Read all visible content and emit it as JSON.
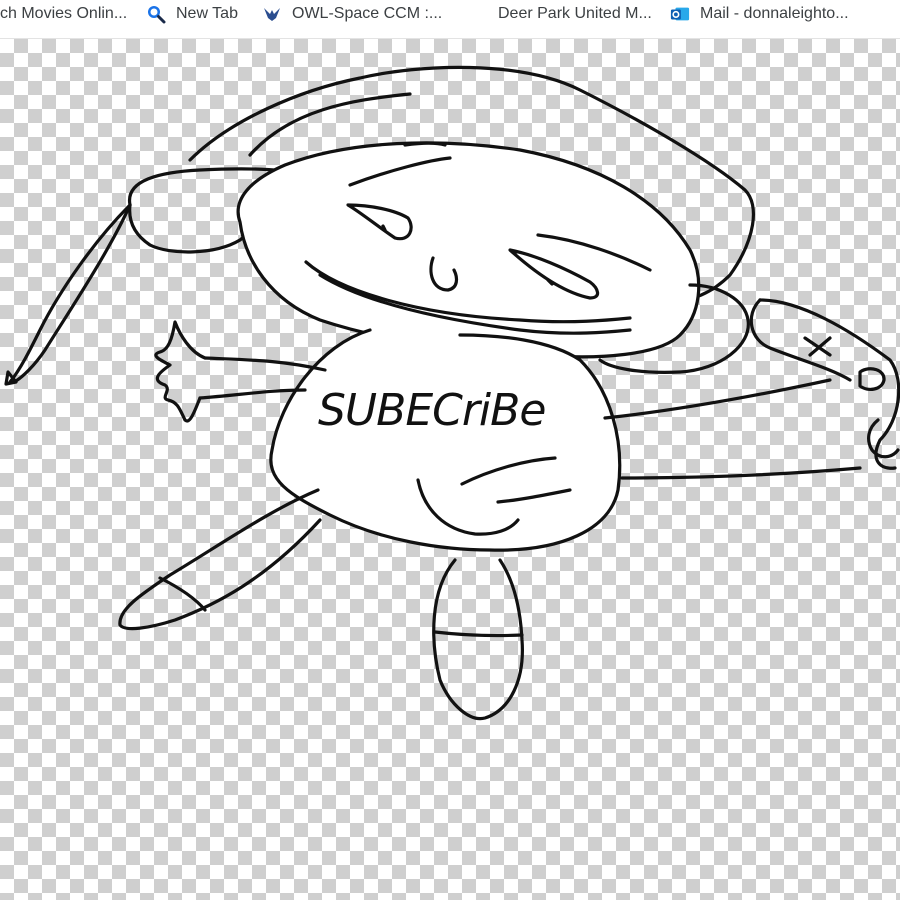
{
  "bookmarks_bar": {
    "items": [
      {
        "label": "ch Movies Onlin...",
        "icon": "none"
      },
      {
        "label": "New Tab",
        "icon": "search-magnifier-icon"
      },
      {
        "label": "OWL-Space CCM :...",
        "icon": "owl-bird-icon"
      },
      {
        "label": "Deer Park United M...",
        "icon": "none"
      },
      {
        "label": "Mail - donnaleighto...",
        "icon": "outlook-mail-icon"
      }
    ]
  },
  "drawing": {
    "shirt_text": "SUBECriBe",
    "background": "transparent-checkerboard",
    "stroke_color": "#111111",
    "checker_color": "#cfcfcf"
  }
}
